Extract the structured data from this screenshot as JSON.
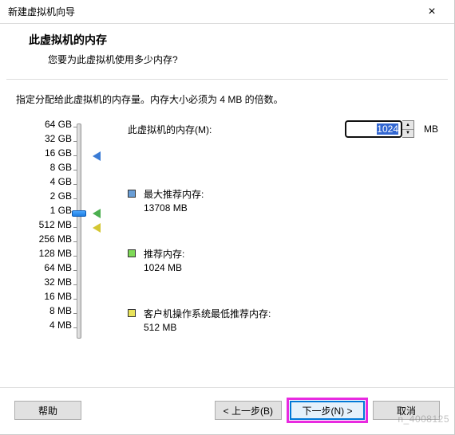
{
  "window": {
    "title": "新建虚拟机向导",
    "close": "×"
  },
  "header": {
    "heading": "此虚拟机的内存",
    "sub": "您要为此虚拟机使用多少内存?"
  },
  "instruction": "指定分配给此虚拟机的内存量。内存大小必须为 4 MB 的倍数。",
  "memory": {
    "label": "此虚拟机的内存(M):",
    "value": "1024",
    "unit": "MB",
    "scale": [
      "64 GB",
      "32 GB",
      "16 GB",
      "8 GB",
      "4 GB",
      "2 GB",
      "1 GB",
      "512 MB",
      "256 MB",
      "128 MB",
      "64 MB",
      "32 MB",
      "16 MB",
      "8 MB",
      "4 MB"
    ],
    "current_index": 6,
    "markers": {
      "max": {
        "index": 2,
        "color": "#3a7bd5",
        "label": "最大推荐内存:",
        "value": "13708 MB"
      },
      "rec": {
        "index": 6,
        "color": "#4caf50",
        "label": "推荐内存:",
        "value": "1024 MB"
      },
      "min": {
        "index": 7,
        "color": "#d4c733",
        "label": "客户机操作系统最低推荐内存:",
        "value": "512 MB"
      }
    }
  },
  "footer": {
    "help": "帮助",
    "back": "< 上一步(B)",
    "next": "下一步(N) >",
    "cancel": "取消"
  },
  "watermark": "n_4008125"
}
